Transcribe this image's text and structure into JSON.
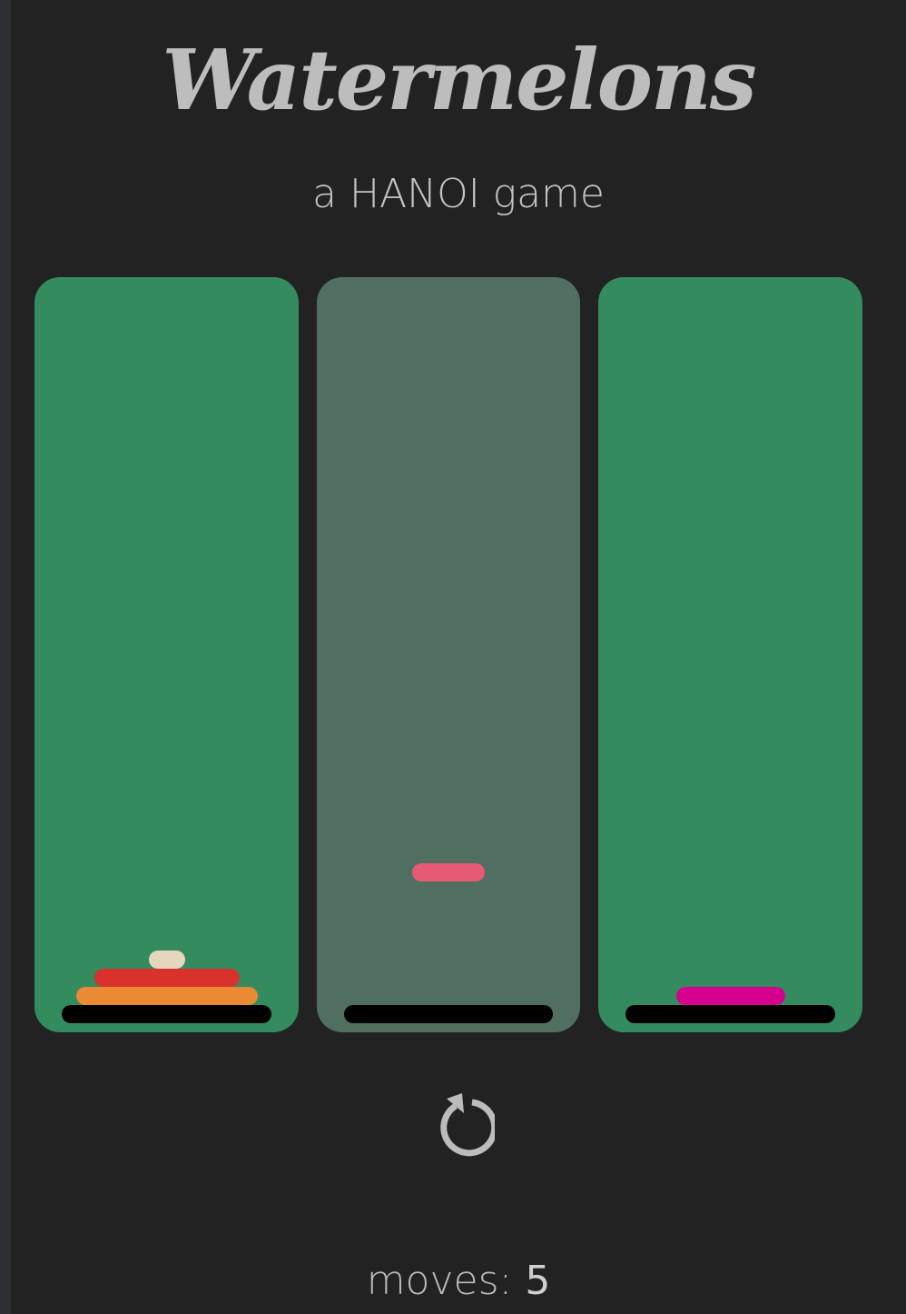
{
  "header": {
    "title": "Watermelons",
    "subtitle": "a HANOI game"
  },
  "towers": [
    {
      "selected": false,
      "discs": [
        {
          "color": "#eb8a35",
          "size": 5
        },
        {
          "color": "#d9322c",
          "size": 4
        },
        {
          "color": "#e4d7bd",
          "size": 1
        }
      ]
    },
    {
      "selected": true,
      "discs": [],
      "lifted_disc": {
        "color": "#e65a73",
        "size": 2
      }
    },
    {
      "selected": false,
      "discs": [
        {
          "color": "#d6008e",
          "size": 3
        }
      ]
    }
  ],
  "colors": {
    "background": "#222222",
    "tower": "#338b5e",
    "tower_selected": "#516f60",
    "base": "#000000"
  },
  "controls": {
    "reset_icon": "reset-icon"
  },
  "status": {
    "moves_label": "moves: ",
    "moves_count": "5"
  }
}
